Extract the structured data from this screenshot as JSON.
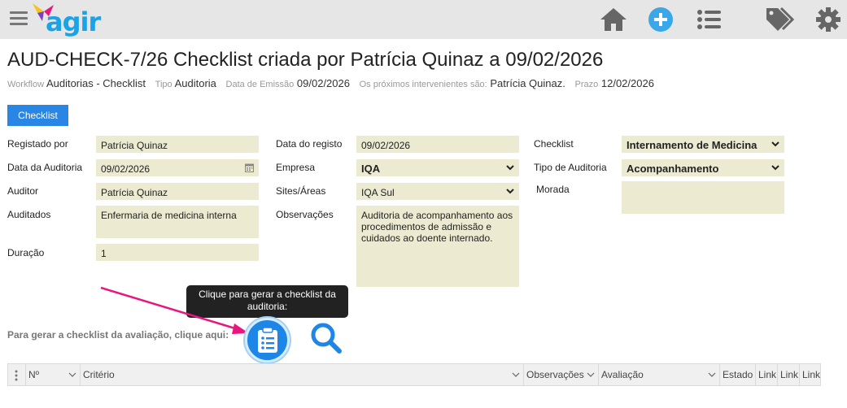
{
  "app": {
    "logo_text": "agir"
  },
  "header": {
    "title": "AUD-CHECK-7/26 Checklist criada por Patrícia Quinaz a 09/02/2026",
    "meta": [
      {
        "label": "Workflow",
        "value": "Auditorias - Checklist"
      },
      {
        "label": "Tipo",
        "value": "Auditoria"
      },
      {
        "label": "Data de Emissão",
        "value": "09/02/2026"
      },
      {
        "label": "Os próximos intervenientes são:",
        "value": "Patrícia Quinaz."
      },
      {
        "label": "Prazo",
        "value": "12/02/2026"
      }
    ]
  },
  "tabs": {
    "checklist": "Checklist"
  },
  "form": {
    "registado_por": {
      "label": "Registado por",
      "value": "Patrícia Quinaz"
    },
    "data_auditoria": {
      "label": "Data da Auditoria",
      "value": "09/02/2026"
    },
    "auditor": {
      "label": "Auditor",
      "value": "Patrícia Quinaz"
    },
    "auditados": {
      "label": "Auditados",
      "value": "Enfermaria de medicina interna"
    },
    "duracao": {
      "label": "Duração",
      "value": "1"
    },
    "data_registo": {
      "label": "Data do registo",
      "value": "09/02/2026"
    },
    "empresa": {
      "label": "Empresa",
      "value": "IQA"
    },
    "sites": {
      "label": "Sites/Áreas",
      "value": "IQA Sul"
    },
    "observacoes": {
      "label": "Observações",
      "value": "Auditoria de acompanhamento aos procedimentos de admissão e cuidados ao doente internado."
    },
    "checklist": {
      "label": "Checklist",
      "value": "Internamento de Medicina"
    },
    "tipo_auditoria": {
      "label": "Tipo de Auditoria",
      "value": "Acompanhamento"
    },
    "morada": {
      "label": "Morada",
      "value": ""
    }
  },
  "generate": {
    "label": "Para gerar a checklist da avaliação, clique aqui:",
    "tooltip": "Clique para gerar a checklist da auditoria:"
  },
  "table": {
    "columns": [
      "Nº",
      "Critério",
      "Observações",
      "Avaliação",
      "Estado",
      "Link",
      "Link",
      "Link"
    ]
  },
  "colors": {
    "accent": "#2a86e4",
    "field_bg": "#ecebd2",
    "arrow": "#e8177f",
    "topbar": "#e6e6e6"
  }
}
